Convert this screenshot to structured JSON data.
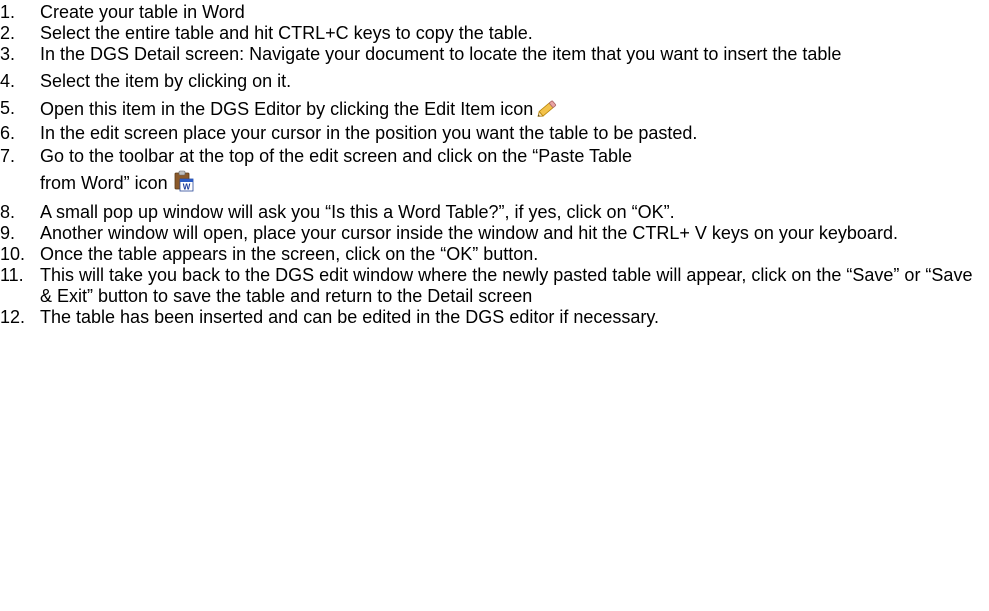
{
  "steps": [
    {
      "num": "1.",
      "text": "Create your table in Word"
    },
    {
      "num": "2.",
      "text": "Select the entire table and hit CTRL+C keys to copy the table."
    },
    {
      "num": "3.",
      "text": "In the DGS Detail screen: Navigate your document to locate the item that you want to insert the table"
    },
    {
      "num": "4.",
      "text": "Select the item by clicking on it."
    },
    {
      "num": "5.",
      "text": "Open this item in the DGS Editor by clicking the Edit Item icon",
      "icon": "pencil-icon"
    },
    {
      "num": "6.",
      "text": "In the edit screen place your cursor in the position you want the table to be pasted."
    },
    {
      "num": "7.",
      "text_line1": "Go to the toolbar at the top of the edit screen and click on the “Paste Table",
      "text_line2": "from Word” icon",
      "icon": "paste-from-word-icon"
    },
    {
      "num": "8.",
      "text": "A small pop up window will ask you “Is this a Word Table?”, if yes, click on “OK”."
    },
    {
      "num": "9.",
      "text": "Another window will open, place your cursor inside the window and hit the CTRL+ V keys on your keyboard."
    },
    {
      "num": "10.",
      "text": "Once the table appears in the screen, click on the “OK” button."
    },
    {
      "num": "11.",
      "text": "This will take you back to the DGS edit window where the newly pasted table will appear, click on the “Save” or “Save & Exit” button to save the table and return to the Detail screen"
    },
    {
      "num": "12.",
      "text": "The table has been inserted and can be edited in the DGS editor if necessary."
    }
  ]
}
